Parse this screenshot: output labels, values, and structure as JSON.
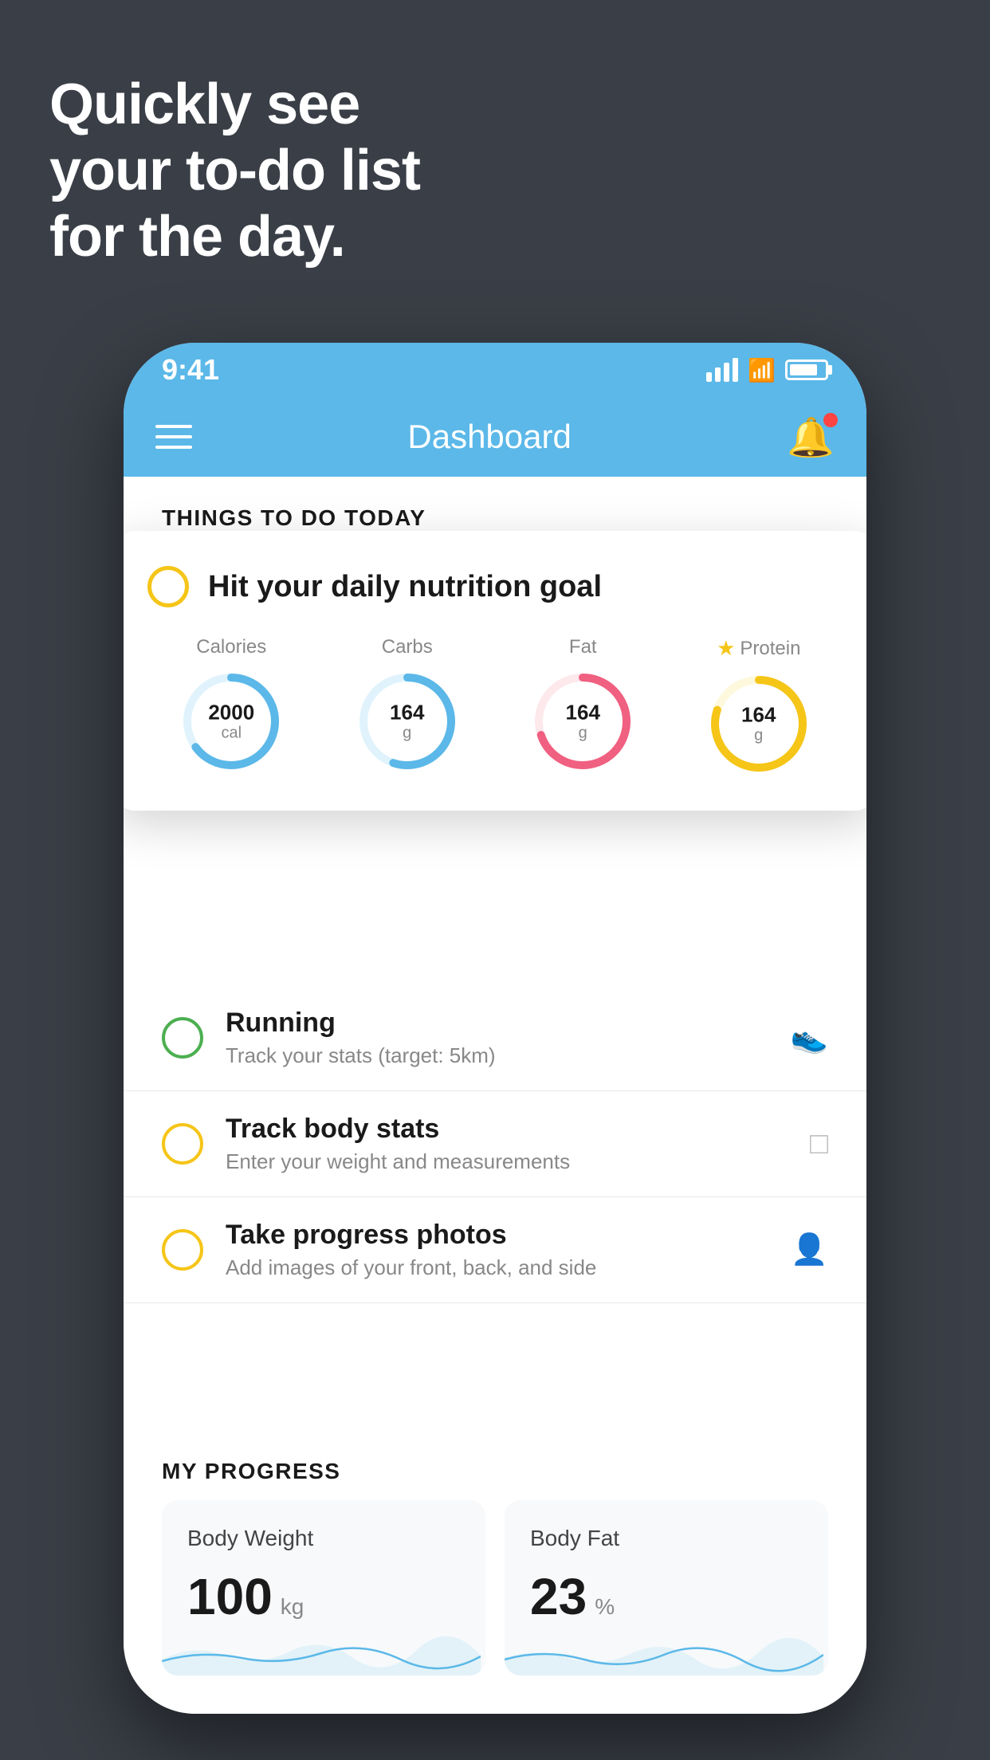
{
  "background": {
    "color": "#3a3f47"
  },
  "headline": {
    "line1": "Quickly see",
    "line2": "your to-do list",
    "line3": "for the day."
  },
  "phone": {
    "status_bar": {
      "time": "9:41"
    },
    "nav": {
      "title": "Dashboard"
    },
    "things_section": {
      "heading": "THINGS TO DO TODAY"
    },
    "floating_card": {
      "circle_color": "#f5c518",
      "title": "Hit your daily nutrition goal",
      "nutrition": [
        {
          "label": "Calories",
          "value": "2000",
          "unit": "cal",
          "ring_color": "#5bb8e8",
          "ring_bg": "#e0f3fc",
          "percent": 65
        },
        {
          "label": "Carbs",
          "value": "164",
          "unit": "g",
          "ring_color": "#5bb8e8",
          "ring_bg": "#e0f3fc",
          "percent": 55
        },
        {
          "label": "Fat",
          "value": "164",
          "unit": "g",
          "ring_color": "#f06080",
          "ring_bg": "#fde8ec",
          "percent": 70
        },
        {
          "label": "Protein",
          "value": "164",
          "unit": "g",
          "ring_color": "#f5c518",
          "ring_bg": "#fef8dc",
          "percent": 80,
          "star": true
        }
      ]
    },
    "todo_items": [
      {
        "circle_color": "green",
        "title": "Running",
        "subtitle": "Track your stats (target: 5km)",
        "icon": "shoe"
      },
      {
        "circle_color": "yellow",
        "title": "Track body stats",
        "subtitle": "Enter your weight and measurements",
        "icon": "scale"
      },
      {
        "circle_color": "yellow",
        "title": "Take progress photos",
        "subtitle": "Add images of your front, back, and side",
        "icon": "person"
      }
    ],
    "progress": {
      "heading": "MY PROGRESS",
      "cards": [
        {
          "title": "Body Weight",
          "value": "100",
          "unit": "kg"
        },
        {
          "title": "Body Fat",
          "value": "23",
          "unit": "%"
        }
      ]
    }
  }
}
